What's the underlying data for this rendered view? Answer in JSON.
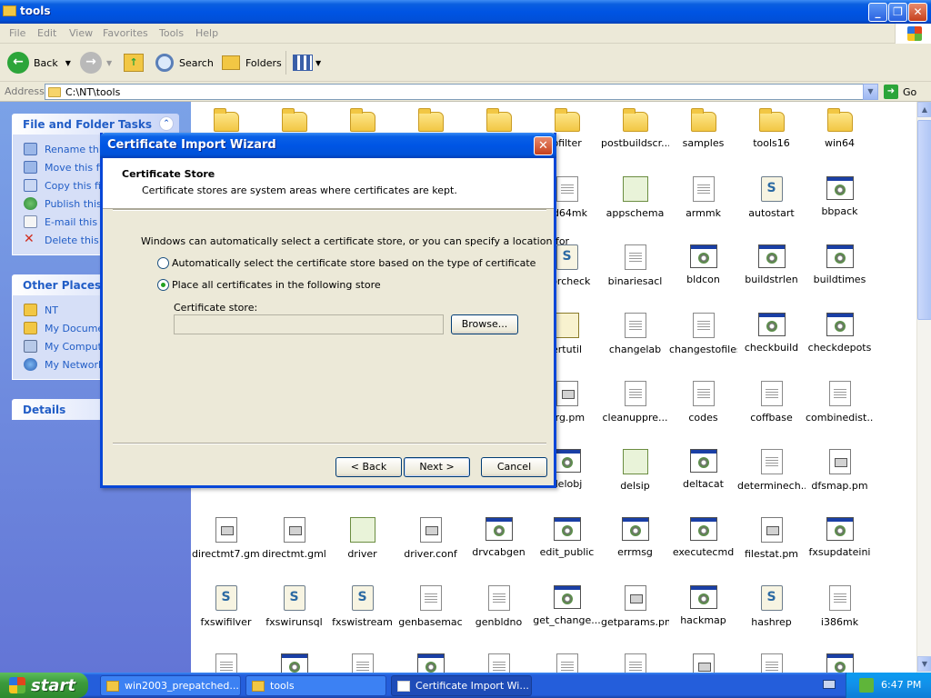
{
  "window": {
    "title": "tools",
    "menu": [
      "File",
      "Edit",
      "View",
      "Favorites",
      "Tools",
      "Help"
    ],
    "toolbar": {
      "back": "Back",
      "search": "Search",
      "folders": "Folders"
    },
    "address_label": "Address",
    "address_value": "C:\\NT\\tools",
    "go_label": "Go"
  },
  "left_pane": {
    "file_tasks_title": "File and Folder Tasks",
    "file_tasks": [
      "Rename this file",
      "Move this file",
      "Copy this file",
      "Publish this file",
      "E-mail this file",
      "Delete this file"
    ],
    "other_places_title": "Other Places",
    "other_places": [
      "NT",
      "My Documents",
      "My Computer",
      "My Network Places"
    ],
    "details_title": "Details"
  },
  "files": [
    {
      "name": "",
      "type": "folder"
    },
    {
      "name": "",
      "type": "folder"
    },
    {
      "name": "",
      "type": "folder"
    },
    {
      "name": "",
      "type": "folder"
    },
    {
      "name": "",
      "type": "folder"
    },
    {
      "name": "pfilter",
      "type": "folder"
    },
    {
      "name": "postbuildscr...",
      "type": "folder"
    },
    {
      "name": "samples",
      "type": "folder"
    },
    {
      "name": "tools16",
      "type": "folder"
    },
    {
      "name": "win64",
      "type": "folder"
    },
    {
      "name": "",
      "type": "hidden"
    },
    {
      "name": "",
      "type": "hidden"
    },
    {
      "name": "",
      "type": "hidden"
    },
    {
      "name": "",
      "type": "hidden"
    },
    {
      "name": "",
      "type": "hidden"
    },
    {
      "name": "nd64mk",
      "type": "doc"
    },
    {
      "name": "appschema",
      "type": "special"
    },
    {
      "name": "armmk",
      "type": "doc"
    },
    {
      "name": "autostart",
      "type": "script"
    },
    {
      "name": "bbpack",
      "type": "exe"
    },
    {
      "name": "",
      "type": "hidden"
    },
    {
      "name": "",
      "type": "hidden"
    },
    {
      "name": "",
      "type": "hidden"
    },
    {
      "name": "",
      "type": "hidden"
    },
    {
      "name": "",
      "type": "hidden"
    },
    {
      "name": "rrorcheck",
      "type": "script"
    },
    {
      "name": "binariesacl",
      "type": "doc"
    },
    {
      "name": "bldcon",
      "type": "exe"
    },
    {
      "name": "buildstrlen",
      "type": "exe"
    },
    {
      "name": "buildtimes",
      "type": "exe"
    },
    {
      "name": "",
      "type": "hidden"
    },
    {
      "name": "",
      "type": "hidden"
    },
    {
      "name": "",
      "type": "hidden"
    },
    {
      "name": "",
      "type": "hidden"
    },
    {
      "name": "",
      "type": "hidden"
    },
    {
      "name": "ertutil",
      "type": "cert"
    },
    {
      "name": "changelab",
      "type": "doc"
    },
    {
      "name": "changestofiles",
      "type": "doc"
    },
    {
      "name": "checkbuild",
      "type": "exe"
    },
    {
      "name": "checkdepots",
      "type": "exe"
    },
    {
      "name": "",
      "type": "hidden"
    },
    {
      "name": "",
      "type": "hidden"
    },
    {
      "name": "",
      "type": "hidden"
    },
    {
      "name": "",
      "type": "hidden"
    },
    {
      "name": "",
      "type": "hidden"
    },
    {
      "name": "arg.pm",
      "type": "gml"
    },
    {
      "name": "cleanuppre...",
      "type": "doc"
    },
    {
      "name": "codes",
      "type": "doc"
    },
    {
      "name": "coffbase",
      "type": "doc"
    },
    {
      "name": "combinedist...",
      "type": "doc"
    },
    {
      "name": "",
      "type": "hidden"
    },
    {
      "name": "",
      "type": "hidden"
    },
    {
      "name": "",
      "type": "hidden"
    },
    {
      "name": "",
      "type": "hidden"
    },
    {
      "name": "",
      "type": "hidden"
    },
    {
      "name": "delobj",
      "type": "exe"
    },
    {
      "name": "delsip",
      "type": "special"
    },
    {
      "name": "deltacat",
      "type": "exe"
    },
    {
      "name": "determinech...",
      "type": "doc"
    },
    {
      "name": "dfsmap.pm",
      "type": "gml"
    },
    {
      "name": "directmt7.gml",
      "type": "gml"
    },
    {
      "name": "directmt.gml",
      "type": "gml"
    },
    {
      "name": "driver",
      "type": "special"
    },
    {
      "name": "driver.conf",
      "type": "gml"
    },
    {
      "name": "drvcabgen",
      "type": "exe"
    },
    {
      "name": "edit_public",
      "type": "exe"
    },
    {
      "name": "errmsg",
      "type": "exe"
    },
    {
      "name": "executecmd",
      "type": "exe"
    },
    {
      "name": "filestat.pm",
      "type": "gml"
    },
    {
      "name": "fxsupdateini",
      "type": "exe"
    },
    {
      "name": "fxswifilver",
      "type": "script"
    },
    {
      "name": "fxswirunsql",
      "type": "script"
    },
    {
      "name": "fxswistream",
      "type": "script"
    },
    {
      "name": "genbasemac",
      "type": "doc"
    },
    {
      "name": "genbldno",
      "type": "doc"
    },
    {
      "name": "get_change...",
      "type": "exe"
    },
    {
      "name": "getparams.pm",
      "type": "gml"
    },
    {
      "name": "hackmap",
      "type": "exe"
    },
    {
      "name": "hashrep",
      "type": "script"
    },
    {
      "name": "i386mk",
      "type": "doc"
    },
    {
      "name": "",
      "type": "doc"
    },
    {
      "name": "",
      "type": "exe"
    },
    {
      "name": "",
      "type": "doc"
    },
    {
      "name": "",
      "type": "exe"
    },
    {
      "name": "",
      "type": "doc"
    },
    {
      "name": "",
      "type": "doc"
    },
    {
      "name": "",
      "type": "doc"
    },
    {
      "name": "",
      "type": "gml"
    },
    {
      "name": "",
      "type": "doc"
    },
    {
      "name": "",
      "type": "exe"
    }
  ],
  "dialog": {
    "title": "Certificate Import Wizard",
    "header_title": "Certificate Store",
    "header_subtitle": "Certificate stores are system areas where certificates are kept.",
    "intro": "Windows can automatically select a certificate store, or you can specify a location for",
    "option_auto": "Automatically select the certificate store based on the type of certificate",
    "option_place": "Place all certificates in the following store",
    "selected_option": "place",
    "store_label": "Certificate store:",
    "store_value": "",
    "browse": "Browse...",
    "back": "< Back",
    "next": "Next >",
    "cancel": "Cancel"
  },
  "taskbar": {
    "start": "start",
    "items": [
      "win2003_prepatched...",
      "tools",
      "Certificate Import Wi..."
    ],
    "active_index": 2,
    "clock": "6:47 PM"
  }
}
